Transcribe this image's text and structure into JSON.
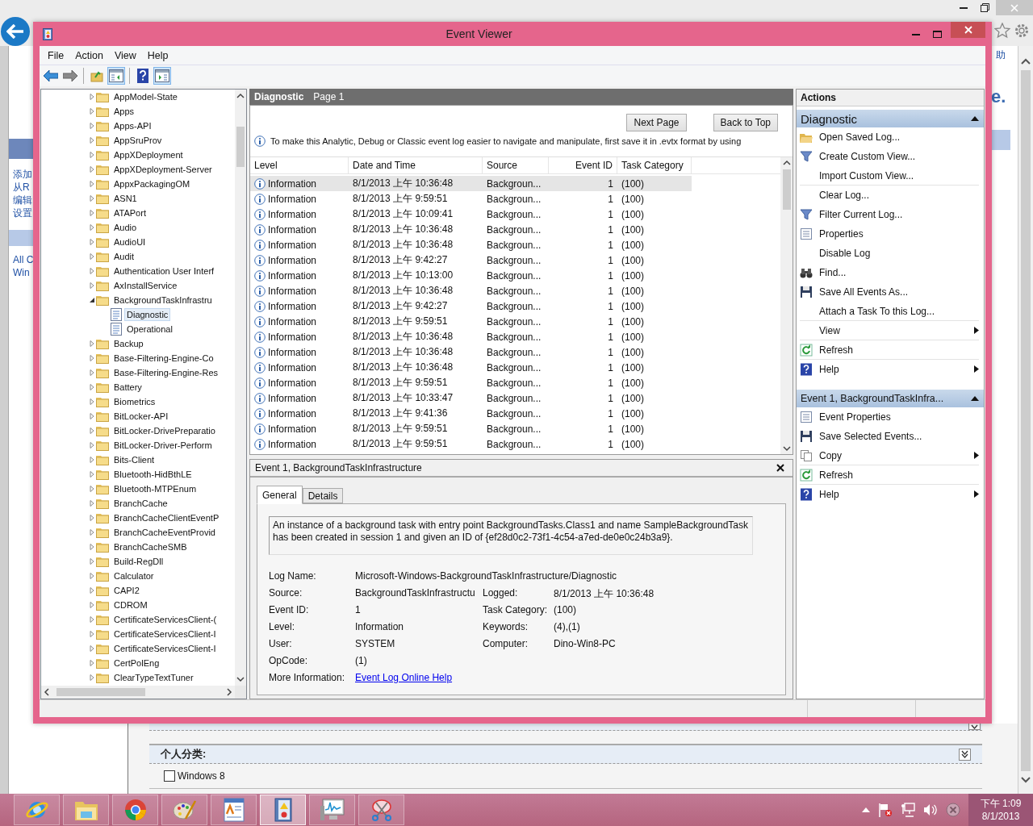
{
  "browser": {
    "sidebar_links": [
      "添加",
      "从R",
      "编辑",
      "设置"
    ],
    "sidebar_links_2": [
      "All C",
      "Win"
    ],
    "right_text": "助",
    "right_heading": "e.",
    "category": {
      "title": "个人分类:",
      "expanded": false
    },
    "checkbox": {
      "label": "Windows 8",
      "checked": false
    }
  },
  "window": {
    "title": "Event Viewer"
  },
  "menu": [
    "File",
    "Action",
    "View",
    "Help"
  ],
  "toolbar": [
    {
      "pressed": false
    },
    {
      "pressed": false
    },
    {
      "pressed": false
    },
    {
      "pressed": true
    },
    {
      "pressed": false
    },
    {
      "pressed": true
    }
  ],
  "tree": [
    {
      "kind": "folder",
      "label": "AppModel-State",
      "expanded": false,
      "selected": false
    },
    {
      "kind": "folder",
      "label": "Apps",
      "expanded": false,
      "selected": false
    },
    {
      "kind": "folder",
      "label": "Apps-API",
      "expanded": false,
      "selected": false
    },
    {
      "kind": "folder",
      "label": "AppSruProv",
      "expanded": false,
      "selected": false
    },
    {
      "kind": "folder",
      "label": "AppXDeployment",
      "expanded": false,
      "selected": false
    },
    {
      "kind": "folder",
      "label": "AppXDeployment-Server",
      "expanded": false,
      "selected": false
    },
    {
      "kind": "folder",
      "label": "AppxPackagingOM",
      "expanded": false,
      "selected": false
    },
    {
      "kind": "folder",
      "label": "ASN1",
      "expanded": false,
      "selected": false
    },
    {
      "kind": "folder",
      "label": "ATAPort",
      "expanded": false,
      "selected": false
    },
    {
      "kind": "folder",
      "label": "Audio",
      "expanded": false,
      "selected": false
    },
    {
      "kind": "folder",
      "label": "AudioUI",
      "expanded": false,
      "selected": false
    },
    {
      "kind": "folder",
      "label": "Audit",
      "expanded": false,
      "selected": false
    },
    {
      "kind": "folder",
      "label": "Authentication User Interf",
      "expanded": false,
      "selected": false
    },
    {
      "kind": "folder",
      "label": "AxInstallService",
      "expanded": false,
      "selected": false
    },
    {
      "kind": "folder",
      "label": "BackgroundTaskInfrastru",
      "expanded": true,
      "selected": false,
      "children": [
        {
          "kind": "log",
          "label": "Diagnostic",
          "selected": true
        },
        {
          "kind": "log",
          "label": "Operational",
          "selected": false
        }
      ]
    },
    {
      "kind": "folder",
      "label": "Backup",
      "expanded": false,
      "selected": false
    },
    {
      "kind": "folder",
      "label": "Base-Filtering-Engine-Co",
      "expanded": false,
      "selected": false
    },
    {
      "kind": "folder",
      "label": "Base-Filtering-Engine-Res",
      "expanded": false,
      "selected": false
    },
    {
      "kind": "folder",
      "label": "Battery",
      "expanded": false,
      "selected": false
    },
    {
      "kind": "folder",
      "label": "Biometrics",
      "expanded": false,
      "selected": false
    },
    {
      "kind": "folder",
      "label": "BitLocker-API",
      "expanded": false,
      "selected": false
    },
    {
      "kind": "folder",
      "label": "BitLocker-DrivePreparatio",
      "expanded": false,
      "selected": false
    },
    {
      "kind": "folder",
      "label": "BitLocker-Driver-Perform",
      "expanded": false,
      "selected": false
    },
    {
      "kind": "folder",
      "label": "Bits-Client",
      "expanded": false,
      "selected": false
    },
    {
      "kind": "folder",
      "label": "Bluetooth-HidBthLE",
      "expanded": false,
      "selected": false
    },
    {
      "kind": "folder",
      "label": "Bluetooth-MTPEnum",
      "expanded": false,
      "selected": false
    },
    {
      "kind": "folder",
      "label": "BranchCache",
      "expanded": false,
      "selected": false
    },
    {
      "kind": "folder",
      "label": "BranchCacheClientEventP",
      "expanded": false,
      "selected": false
    },
    {
      "kind": "folder",
      "label": "BranchCacheEventProvid",
      "expanded": false,
      "selected": false
    },
    {
      "kind": "folder",
      "label": "BranchCacheSMB",
      "expanded": false,
      "selected": false
    },
    {
      "kind": "folder",
      "label": "Build-RegDll",
      "expanded": false,
      "selected": false
    },
    {
      "kind": "folder",
      "label": "Calculator",
      "expanded": false,
      "selected": false
    },
    {
      "kind": "folder",
      "label": "CAPI2",
      "expanded": false,
      "selected": false
    },
    {
      "kind": "folder",
      "label": "CDROM",
      "expanded": false,
      "selected": false
    },
    {
      "kind": "folder",
      "label": "CertificateServicesClient-(",
      "expanded": false,
      "selected": false
    },
    {
      "kind": "folder",
      "label": "CertificateServicesClient-I",
      "expanded": false,
      "selected": false
    },
    {
      "kind": "folder",
      "label": "CertificateServicesClient-I",
      "expanded": false,
      "selected": false
    },
    {
      "kind": "folder",
      "label": "CertPolEng",
      "expanded": false,
      "selected": false
    },
    {
      "kind": "folder",
      "label": "ClearTypeTextTuner",
      "expanded": false,
      "selected": false
    }
  ],
  "pane": {
    "title": "Diagnostic",
    "page": "Page 1",
    "buttons": [
      "Next Page",
      "Back to Top"
    ],
    "info": "To make this Analytic, Debug or Classic event log easier to navigate and manipulate, first save it in .evtx format by using"
  },
  "table": {
    "columns": [
      "Level",
      "Date and Time",
      "Source",
      "Event ID",
      "Task Category"
    ],
    "rows": [
      {
        "level": "Information",
        "date": "8/1/2013 上午 10:36:48",
        "source": "Backgroun...",
        "event_id": "1",
        "category": "(100)",
        "selected": true
      },
      {
        "level": "Information",
        "date": "8/1/2013 上午 9:59:51",
        "source": "Backgroun...",
        "event_id": "1",
        "category": "(100)",
        "selected": false
      },
      {
        "level": "Information",
        "date": "8/1/2013 上午 10:09:41",
        "source": "Backgroun...",
        "event_id": "1",
        "category": "(100)",
        "selected": false
      },
      {
        "level": "Information",
        "date": "8/1/2013 上午 10:36:48",
        "source": "Backgroun...",
        "event_id": "1",
        "category": "(100)",
        "selected": false
      },
      {
        "level": "Information",
        "date": "8/1/2013 上午 10:36:48",
        "source": "Backgroun...",
        "event_id": "1",
        "category": "(100)",
        "selected": false
      },
      {
        "level": "Information",
        "date": "8/1/2013 上午 9:42:27",
        "source": "Backgroun...",
        "event_id": "1",
        "category": "(100)",
        "selected": false
      },
      {
        "level": "Information",
        "date": "8/1/2013 上午 10:13:00",
        "source": "Backgroun...",
        "event_id": "1",
        "category": "(100)",
        "selected": false
      },
      {
        "level": "Information",
        "date": "8/1/2013 上午 10:36:48",
        "source": "Backgroun...",
        "event_id": "1",
        "category": "(100)",
        "selected": false
      },
      {
        "level": "Information",
        "date": "8/1/2013 上午 9:42:27",
        "source": "Backgroun...",
        "event_id": "1",
        "category": "(100)",
        "selected": false
      },
      {
        "level": "Information",
        "date": "8/1/2013 上午 9:59:51",
        "source": "Backgroun...",
        "event_id": "1",
        "category": "(100)",
        "selected": false
      },
      {
        "level": "Information",
        "date": "8/1/2013 上午 10:36:48",
        "source": "Backgroun...",
        "event_id": "1",
        "category": "(100)",
        "selected": false
      },
      {
        "level": "Information",
        "date": "8/1/2013 上午 10:36:48",
        "source": "Backgroun...",
        "event_id": "1",
        "category": "(100)",
        "selected": false
      },
      {
        "level": "Information",
        "date": "8/1/2013 上午 10:36:48",
        "source": "Backgroun...",
        "event_id": "1",
        "category": "(100)",
        "selected": false
      },
      {
        "level": "Information",
        "date": "8/1/2013 上午 9:59:51",
        "source": "Backgroun...",
        "event_id": "1",
        "category": "(100)",
        "selected": false
      },
      {
        "level": "Information",
        "date": "8/1/2013 上午 10:33:47",
        "source": "Backgroun...",
        "event_id": "1",
        "category": "(100)",
        "selected": false
      },
      {
        "level": "Information",
        "date": "8/1/2013 上午 9:41:36",
        "source": "Backgroun...",
        "event_id": "1",
        "category": "(100)",
        "selected": false
      },
      {
        "level": "Information",
        "date": "8/1/2013 上午 9:59:51",
        "source": "Backgroun...",
        "event_id": "1",
        "category": "(100)",
        "selected": false
      },
      {
        "level": "Information",
        "date": "8/1/2013 上午 9:59:51",
        "source": "Backgroun...",
        "event_id": "1",
        "category": "(100)",
        "selected": false
      }
    ]
  },
  "details": {
    "title": "Event 1, BackgroundTaskInfrastructure",
    "tabs": [
      {
        "label": "General",
        "selected": true
      },
      {
        "label": "Details",
        "selected": false
      }
    ],
    "description": "An instance of a background task with entry point BackgroundTasks.Class1 and name SampleBackgroundTask has been created in session 1 and given an ID of {ef28d0c2-73f1-4c54-a7ed-de0e0c24b3a9}.",
    "fields": [
      {
        "label": "Log Name:",
        "value": "Microsoft-Windows-BackgroundTaskInfrastructure/Diagnostic"
      },
      {
        "label": "Source:",
        "value": "BackgroundTaskInfrastructu",
        "label_2": "Logged:",
        "value_2": "8/1/2013 上午 10:36:48"
      },
      {
        "label": "Event ID:",
        "value": "1",
        "label_2": "Task Category:",
        "value_2": "(100)"
      },
      {
        "label": "Level:",
        "value": "Information",
        "label_2": "Keywords:",
        "value_2": "(4),(1)"
      },
      {
        "label": "User:",
        "value": "SYSTEM",
        "label_2": "Computer:",
        "value_2": "Dino-Win8-PC"
      },
      {
        "label": "OpCode:",
        "value": "(1)"
      }
    ],
    "more_info": {
      "label": "More Information:",
      "link": "Event Log Online Help"
    }
  },
  "actions": {
    "title": "Actions",
    "sections": [
      {
        "title": "Diagnostic",
        "expanded": true,
        "items": [
          {
            "label": "Open Saved Log...",
            "submenu": false,
            "separator": false
          },
          {
            "label": "Create Custom View...",
            "submenu": false,
            "separator": false
          },
          {
            "label": "Import Custom View...",
            "submenu": false,
            "separator": true
          },
          {
            "label": "Clear Log...",
            "submenu": false,
            "separator": false
          },
          {
            "label": "Filter Current Log...",
            "submenu": false,
            "separator": false
          },
          {
            "label": "Properties",
            "submenu": false,
            "separator": false
          },
          {
            "label": "Disable Log",
            "submenu": false,
            "separator": false
          },
          {
            "label": "Find...",
            "submenu": false,
            "separator": false
          },
          {
            "label": "Save All Events As...",
            "submenu": false,
            "separator": false
          },
          {
            "label": "Attach a Task To this Log...",
            "submenu": false,
            "separator": true
          },
          {
            "label": "View",
            "submenu": true,
            "separator": true
          },
          {
            "label": "Refresh",
            "submenu": false,
            "separator": true
          },
          {
            "label": "Help",
            "submenu": true,
            "separator": false
          }
        ]
      },
      {
        "title": "Event 1, BackgroundTaskInfra...",
        "expanded": true,
        "items": [
          {
            "label": "Event Properties",
            "submenu": false,
            "separator": false
          },
          {
            "label": "Save Selected Events...",
            "submenu": false,
            "separator": false
          },
          {
            "label": "Copy",
            "submenu": true,
            "separator": true
          },
          {
            "label": "Refresh",
            "submenu": false,
            "separator": true
          },
          {
            "label": "Help",
            "submenu": true,
            "separator": false
          }
        ]
      }
    ]
  },
  "taskbar": {
    "apps": [
      {
        "selected": false
      },
      {
        "selected": false
      },
      {
        "selected": false
      },
      {
        "selected": false
      },
      {
        "selected": false
      },
      {
        "selected": true
      },
      {
        "selected": false
      },
      {
        "selected": false
      }
    ],
    "clock": {
      "time": "下午 1:09",
      "date": "8/1/2013"
    }
  }
}
